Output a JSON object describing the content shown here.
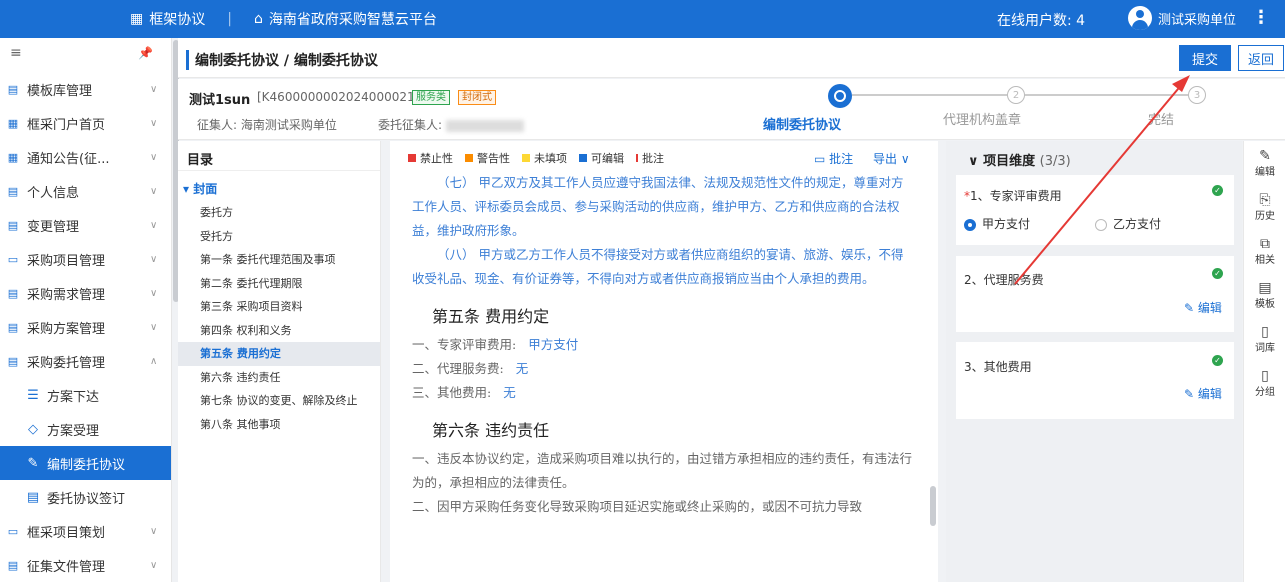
{
  "topbar": {
    "module_icon": "grid-icon",
    "module": "框架协议",
    "home_icon": "home-icon",
    "platform": "海南省政府采购智慧云平台",
    "online_label": "在线用户数:",
    "online_count": "4",
    "user_name": "测试采购单位"
  },
  "sidebar": {
    "items": [
      {
        "label": "模板库管理",
        "icon": "doc-icon"
      },
      {
        "label": "框采门户首页",
        "icon": "grid-icon"
      },
      {
        "label": "通知公告(征...",
        "icon": "grid-icon"
      },
      {
        "label": "个人信息",
        "icon": "doc-icon"
      },
      {
        "label": "变更管理",
        "icon": "doc-icon"
      },
      {
        "label": "采购项目管理",
        "icon": "folder-icon"
      },
      {
        "label": "采购需求管理",
        "icon": "doc-icon"
      },
      {
        "label": "采购方案管理",
        "icon": "doc-icon"
      },
      {
        "label": "采购委托管理",
        "icon": "doc-icon"
      }
    ],
    "sub_items": [
      {
        "label": "方案下达"
      },
      {
        "label": "方案受理"
      },
      {
        "label": "编制委托协议"
      },
      {
        "label": "委托协议签订"
      }
    ],
    "tail_items": [
      {
        "label": "框采项目策划"
      },
      {
        "label": "征集文件管理"
      }
    ]
  },
  "header": {
    "breadcrumb": "编制委托协议 / 编制委托协议",
    "submit": "提交",
    "back": "返回"
  },
  "project": {
    "title": "测试1sun",
    "code": "[K4600000002024000021]",
    "tag1": "服务类",
    "tag2": "封闭式",
    "collector_label": "征集人:",
    "collector": "海南测试采购单位",
    "entrust_label": "委托征集人:"
  },
  "steps": [
    {
      "label": "编制委托协议",
      "num": ""
    },
    {
      "label": "代理机构盖章",
      "num": "2"
    },
    {
      "label": "完结",
      "num": "3"
    }
  ],
  "toc": {
    "title": "目录",
    "group": "封面",
    "items": [
      "委托方",
      "受托方",
      "第一条 委托代理范围及事项",
      "第二条 委托代理期限",
      "第三条 采购项目资料",
      "第四条 权利和义务",
      "第五条 费用约定",
      "第六条 违约责任",
      "第七条 协议的变更、解除及终止",
      "第八条 其他事项"
    ]
  },
  "legend": {
    "items": [
      {
        "label": "禁止性",
        "color": "#e53935"
      },
      {
        "label": "警告性",
        "color": "#fb8c00"
      },
      {
        "label": "未填项",
        "color": "#fdd835"
      },
      {
        "label": "可编辑",
        "color": "#1a6fd3"
      },
      {
        "label": "批注",
        "color": "#e53935"
      }
    ],
    "comment": "批注",
    "export": "导出"
  },
  "doc": {
    "p7": "（七） 甲乙双方及其工作人员应遵守我国法律、法规及规范性文件的规定，尊重对方工作人员、评标委员会成员、参与采购活动的供应商，维护甲方、乙方和供应商的合法权益，维护政府形象。",
    "p8": "（八） 甲方或乙方工作人员不得接受对方或者供应商组织的宴请、旅游、娱乐，不得收受礼品、现金、有价证券等，不得向对方或者供应商报销应当由个人承担的费用。",
    "sec5": "第五条 费用约定",
    "fee1_label": "一、专家评审费用:",
    "fee1_value": "甲方支付",
    "fee2_label": "二、代理服务费:",
    "fee2_value": "无",
    "fee3_label": "三、其他费用:",
    "fee3_value": "无",
    "sec6": "第六条 违约责任",
    "b1": "一、违反本协议约定，造成采购项目难以执行的，由过错方承担相应的违约责任，有违法行为的，承担相应的法律责任。",
    "b2": "二、因甲方采购任务变化导致采购项目延迟实施或终止采购的，或因不可抗力导致"
  },
  "right": {
    "head": "项目维度",
    "count": "(3/3)",
    "f1_star": "*",
    "f1": "1、专家评审费用",
    "opt_a": "甲方支付",
    "opt_b": "乙方支付",
    "f2": "2、代理服务费",
    "f3": "3、其他费用",
    "edit": "编辑"
  },
  "tools": [
    "编辑",
    "历史",
    "相关",
    "模板",
    "词库",
    "分组"
  ]
}
